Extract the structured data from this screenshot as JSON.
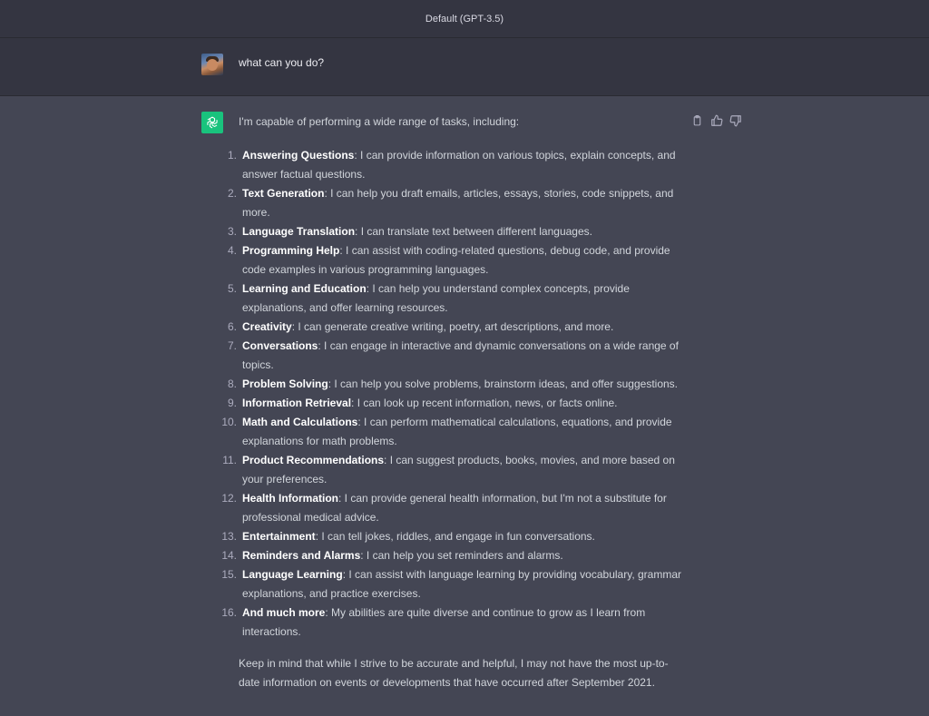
{
  "header": {
    "title": "Default (GPT-3.5)"
  },
  "user_message": {
    "text": "what can you do?"
  },
  "assistant_message": {
    "intro": "I'm capable of performing a wide range of tasks, including:",
    "items": [
      {
        "num": "1.",
        "title": "Answering Questions",
        "desc": ": I can provide information on various topics, explain concepts, and answer factual questions."
      },
      {
        "num": "2.",
        "title": "Text Generation",
        "desc": ": I can help you draft emails, articles, essays, stories, code snippets, and more."
      },
      {
        "num": "3.",
        "title": "Language Translation",
        "desc": ": I can translate text between different languages."
      },
      {
        "num": "4.",
        "title": "Programming Help",
        "desc": ": I can assist with coding-related questions, debug code, and provide code examples in various programming languages."
      },
      {
        "num": "5.",
        "title": "Learning and Education",
        "desc": ": I can help you understand complex concepts, provide explanations, and offer learning resources."
      },
      {
        "num": "6.",
        "title": "Creativity",
        "desc": ": I can generate creative writing, poetry, art descriptions, and more."
      },
      {
        "num": "7.",
        "title": "Conversations",
        "desc": ": I can engage in interactive and dynamic conversations on a wide range of topics."
      },
      {
        "num": "8.",
        "title": "Problem Solving",
        "desc": ": I can help you solve problems, brainstorm ideas, and offer suggestions."
      },
      {
        "num": "9.",
        "title": "Information Retrieval",
        "desc": ": I can look up recent information, news, or facts online."
      },
      {
        "num": "10.",
        "title": "Math and Calculations",
        "desc": ": I can perform mathematical calculations, equations, and provide explanations for math problems."
      },
      {
        "num": "11.",
        "title": "Product Recommendations",
        "desc": ": I can suggest products, books, movies, and more based on your preferences."
      },
      {
        "num": "12.",
        "title": "Health Information",
        "desc": ": I can provide general health information, but I'm not a substitute for professional medical advice."
      },
      {
        "num": "13.",
        "title": "Entertainment",
        "desc": ": I can tell jokes, riddles, and engage in fun conversations."
      },
      {
        "num": "14.",
        "title": "Reminders and Alarms",
        "desc": ": I can help you set reminders and alarms."
      },
      {
        "num": "15.",
        "title": "Language Learning",
        "desc": ": I can assist with language learning by providing vocabulary, grammar explanations, and practice exercises."
      },
      {
        "num": "16.",
        "title": "And much more",
        "desc": ": My abilities are quite diverse and continue to grow as I learn from interactions."
      }
    ],
    "outro": "Keep in mind that while I strive to be accurate and helpful, I may not have the most up-to-date information on events or developments that have occurred after September 2021."
  },
  "actions": {
    "copy_icon": "clipboard-icon",
    "like_icon": "thumbs-up-icon",
    "dislike_icon": "thumbs-down-icon"
  },
  "colors": {
    "background": "#444654",
    "user_row": "#343541",
    "brand": "#19c37d"
  }
}
